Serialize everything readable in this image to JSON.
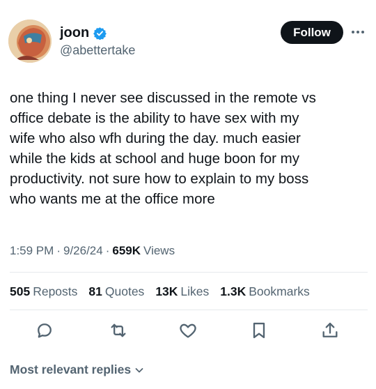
{
  "author": {
    "display_name": "joon",
    "handle": "@abettertake",
    "verified_icon": "verified-badge-icon",
    "verified_color": "#1d9bf0"
  },
  "follow_label": "Follow",
  "tweet_text": "one thing I never see discussed in the remote vs\noffice debate is the ability to have sex with my\nwife who also wfh during the day. much easier\nwhile the kids at school and huge boon for my\nproductivity. not sure how to explain to my boss\nwho wants me at the office more",
  "meta": {
    "time": "1:59 PM",
    "date": "9/26/24",
    "views_count": "659K",
    "views_label": "Views",
    "separator": "·"
  },
  "stats": [
    {
      "count": "505",
      "label": "Reposts"
    },
    {
      "count": "81",
      "label": "Quotes"
    },
    {
      "count": "13K",
      "label": "Likes"
    },
    {
      "count": "1.3K",
      "label": "Bookmarks"
    }
  ],
  "actions": [
    "reply-icon",
    "repost-icon",
    "like-icon",
    "bookmark-icon",
    "share-icon"
  ],
  "replies_sort_label": "Most relevant replies",
  "colors": {
    "text": "#0f1419",
    "secondary": "#536471",
    "follow_bg": "#0f1419",
    "divider": "#e6e9ec"
  }
}
